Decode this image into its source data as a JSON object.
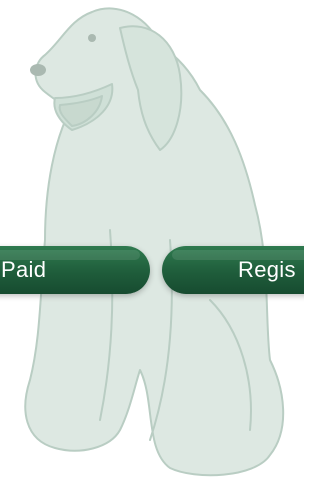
{
  "buttons": {
    "left_label": "Paid",
    "right_label": "Regis"
  },
  "colors": {
    "accent": "#1f5d3b",
    "accent_light": "#2f7a4f",
    "dog_fill": "#dde8e2",
    "dog_stroke": "#b9cdc3"
  },
  "background": {
    "image": "golden-retriever-illustration"
  }
}
